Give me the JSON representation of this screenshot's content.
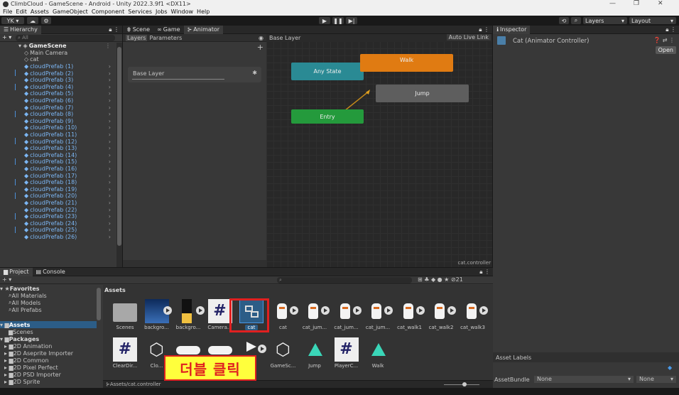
{
  "window": {
    "title": "ClimbCloud - GameScene - Android - Unity 2022.3.9f1 <DX11>"
  },
  "menu": [
    "File",
    "Edit",
    "Assets",
    "GameObject",
    "Component",
    "Services",
    "Jobs",
    "Window",
    "Help"
  ],
  "toolbar": {
    "account": "YK ▾",
    "layers": "Layers",
    "layout": "Layout"
  },
  "hierarchy": {
    "tab": "Hierarchy",
    "search": "All",
    "scene": "GameScene",
    "items": [
      "Main Camera",
      "cat",
      "cloudPrefab (1)",
      "cloudPrefab (2)",
      "cloudPrefab (3)",
      "cloudPrefab (4)",
      "cloudPrefab (5)",
      "cloudPrefab (6)",
      "cloudPrefab (7)",
      "cloudPrefab (8)",
      "cloudPrefab (9)",
      "cloudPrefab (10)",
      "cloudPrefab (11)",
      "cloudPrefab (12)",
      "cloudPrefab (13)",
      "cloudPrefab (14)",
      "cloudPrefab (15)",
      "cloudPrefab (16)",
      "cloudPrefab (17)",
      "cloudPrefab (18)",
      "cloudPrefab (19)",
      "cloudPrefab (20)",
      "cloudPrefab (21)",
      "cloudPrefab (22)",
      "cloudPrefab (23)",
      "cloudPrefab (24)",
      "cloudPrefab (25)",
      "cloudPrefab (26)"
    ]
  },
  "center_tabs": {
    "scene": "Scene",
    "game": "Game",
    "animator": "Animator"
  },
  "animator": {
    "layers_tab": "Layers",
    "params_tab": "Parameters",
    "base_layer_row": "Base Layer",
    "breadcrumb": "Base Layer",
    "auto_live": "Auto Live Link",
    "file": "cat.controller",
    "nodes": {
      "any": "Any State",
      "walk": "Walk",
      "jump": "Jump",
      "entry": "Entry"
    }
  },
  "inspector": {
    "tab": "Inspector",
    "title": "Cat (Animator Controller)",
    "open": "Open",
    "asset_labels": "Asset Labels",
    "assetbundle": "AssetBundle",
    "none1": "None",
    "none2": "None"
  },
  "project": {
    "tab": "Project",
    "console_tab": "Console",
    "hidden_count": "21",
    "tree": {
      "favorites": "Favorites",
      "fav_items": [
        "All Materials",
        "All Models",
        "All Prefabs"
      ],
      "assets": "Assets",
      "scenes": "Scenes",
      "packages": "Packages",
      "pkgs": [
        "2D Animation",
        "2D Aseprite Importer",
        "2D Common",
        "2D Pixel Perfect",
        "2D PSD Importer",
        "2D Sprite"
      ]
    },
    "header": "Assets",
    "row1": [
      "Scenes",
      "backgro...",
      "backgro...",
      "Camera...",
      "cat",
      "cat",
      "cat_jum...",
      "cat_jum...",
      "cat_jum...",
      "cat_walk1",
      "cat_walk2",
      "cat_walk3"
    ],
    "row2": [
      "ClearDir...",
      "Clo...",
      "",
      "",
      "",
      "GameSc...",
      "Jump",
      "PlayerC...",
      "Walk"
    ],
    "path": "Assets/cat.controller"
  },
  "annotation": {
    "text": "더블 클릭"
  },
  "colors": {
    "walk": "#e07b12",
    "entry": "#249a3c",
    "highlight": "#e02020",
    "annot_bg": "#ffff3c"
  }
}
